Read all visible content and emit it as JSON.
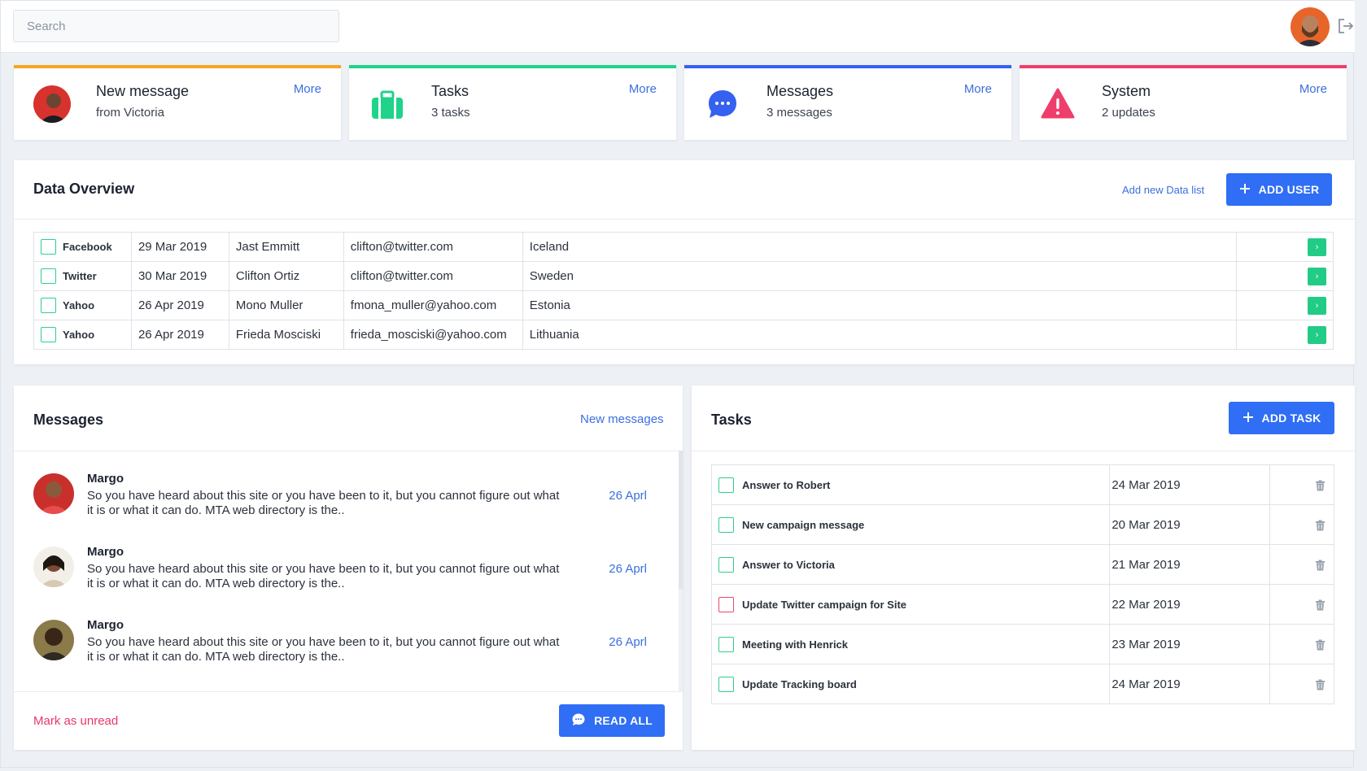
{
  "search": {
    "placeholder": "Search"
  },
  "colors": {
    "accent": "#2f6ef5",
    "green": "#22cc86",
    "orange": "#f5a623",
    "blue": "#3561f0",
    "red": "#ef3e6b"
  },
  "stats": [
    {
      "title": "New message",
      "sub": "from Victoria",
      "more": "More",
      "color": "#f5a623",
      "icon": "avatar"
    },
    {
      "title": "Tasks",
      "sub": "3 tasks",
      "more": "More",
      "color": "#1fd38a",
      "icon": "briefcase-icon"
    },
    {
      "title": "Messages",
      "sub": "3 messages",
      "more": "More",
      "color": "#3561f0",
      "icon": "chat-bubble-icon"
    },
    {
      "title": "System",
      "sub": "2 updates",
      "more": "More",
      "color": "#ef3e6b",
      "icon": "warning-icon"
    }
  ],
  "overview": {
    "title": "Data Overview",
    "add_list": "Add new Data list",
    "add_user": "ADD USER",
    "rows": [
      {
        "source": "Facebook",
        "date": "29 Mar 2019",
        "name": "Jast Emmitt",
        "email": "clifton@twitter.com",
        "country": "Iceland"
      },
      {
        "source": "Twitter",
        "date": "30 Mar 2019",
        "name": "Clifton Ortiz",
        "email": "clifton@twitter.com",
        "country": "Sweden"
      },
      {
        "source": "Yahoo",
        "date": "26 Apr 2019",
        "name": "Mono Muller",
        "email": "fmona_muller@yahoo.com",
        "country": "Estonia"
      },
      {
        "source": "Yahoo",
        "date": "26 Apr 2019",
        "name": "Frieda Mosciski",
        "email": "frieda_mosciski@yahoo.com",
        "country": "Lithuania"
      }
    ]
  },
  "messages": {
    "title": "Messages",
    "new_link": "New messages",
    "mark_unread": "Mark as unread",
    "read_all": "READ ALL",
    "items": [
      {
        "name": "Margo",
        "text": "So you have heard about this site or you have been to it, but you cannot figure out what it is or what it can do. MTA web directory is the..",
        "date": "26 Aprl"
      },
      {
        "name": "Margo",
        "text": "So you have heard about this site or you have been to it, but you cannot figure out what it is or what it can do. MTA web directory is the..",
        "date": "26 Aprl"
      },
      {
        "name": "Margo",
        "text": "So you have heard about this site or you have been to it, but you cannot figure out what it is or what it can do. MTA web directory is the..",
        "date": "26 Aprl"
      }
    ]
  },
  "tasks": {
    "title": "Tasks",
    "add_task": "ADD TASK",
    "items": [
      {
        "label": "Answer to Robert",
        "date": "24 Mar 2019",
        "flag": "green"
      },
      {
        "label": "New campaign message",
        "date": "20 Mar 2019",
        "flag": "green"
      },
      {
        "label": "Answer to Victoria",
        "date": "21 Mar 2019",
        "flag": "green"
      },
      {
        "label": "Update Twitter campaign for Site",
        "date": "22 Mar 2019",
        "flag": "red"
      },
      {
        "label": "Meeting with Henrick",
        "date": "23 Mar 2019",
        "flag": "green"
      },
      {
        "label": "Update Tracking board",
        "date": "24 Mar 2019",
        "flag": "green"
      }
    ]
  }
}
